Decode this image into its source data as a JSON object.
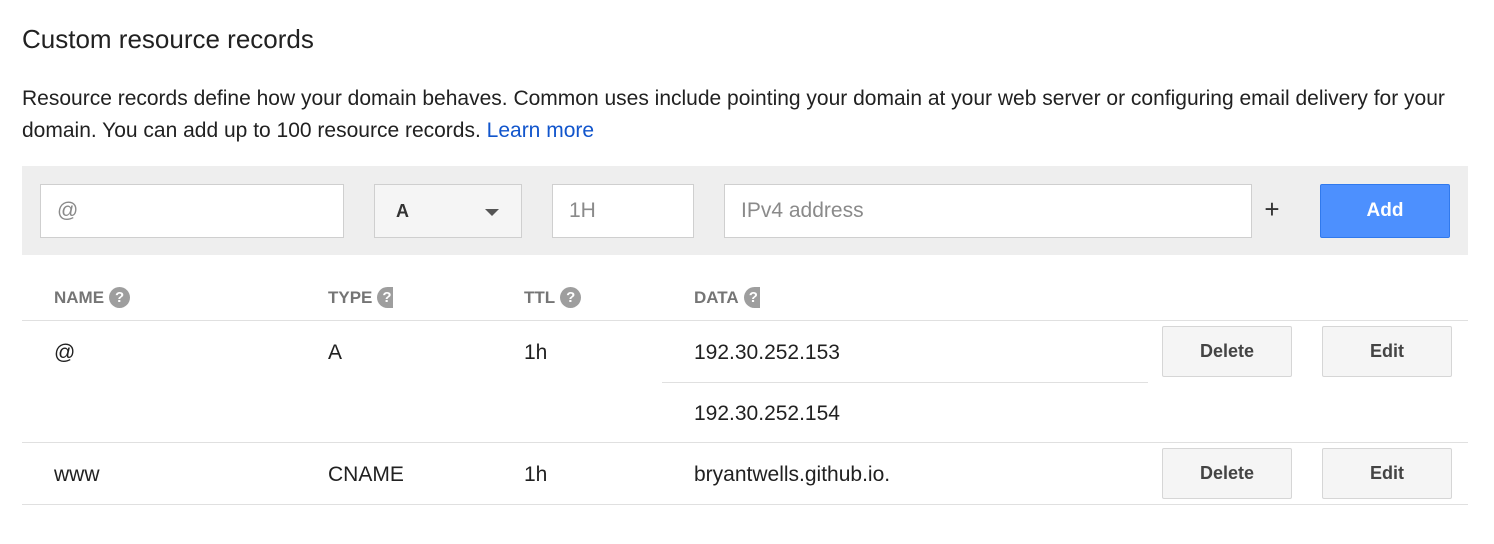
{
  "heading": "Custom resource records",
  "description": {
    "text": "Resource records define how your domain behaves. Common uses include pointing your domain at your web server or configuring email delivery for your domain. You can add up to 100 resource records.",
    "link": "Learn more"
  },
  "form": {
    "name_placeholder": "@",
    "type_value": "A",
    "ttl_placeholder": "1H",
    "data_placeholder": "IPv4 address",
    "plus_label": "+",
    "add_label": "Add"
  },
  "table": {
    "headers": [
      "NAME",
      "TYPE",
      "TTL",
      "DATA"
    ],
    "help_glyph": "?",
    "records": [
      {
        "name": "@",
        "type": "A",
        "ttl": "1h",
        "data": [
          "192.30.252.153",
          "192.30.252.154"
        ],
        "delete_label": "Delete",
        "edit_label": "Edit"
      },
      {
        "name": "www",
        "type": "CNAME",
        "ttl": "1h",
        "data": [
          "bryantwells.github.io."
        ],
        "delete_label": "Delete",
        "edit_label": "Edit"
      }
    ]
  },
  "icons": {
    "help": "help-circle-icon",
    "dropdown": "chevron-down-icon"
  },
  "colors": {
    "link": "#1155cc",
    "primary_button": "#4d90fe",
    "form_background": "#eeeeee"
  }
}
